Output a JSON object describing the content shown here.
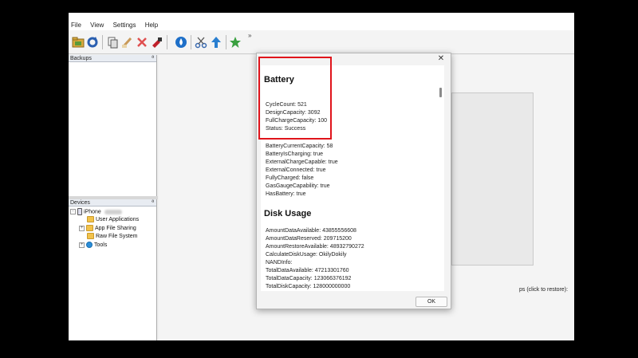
{
  "app": {
    "title": "",
    "menu": [
      "File",
      "View",
      "Settings",
      "Help"
    ],
    "toolbar_overflow": "»",
    "toolbar_icons": [
      "open-folder-icon",
      "refresh-icon",
      "copy-icon",
      "clean-icon",
      "delete-icon",
      "tool-red-icon",
      "water-drop-icon",
      "scissors-icon",
      "upload-arrow-icon",
      "star-icon"
    ]
  },
  "panels": {
    "backups": {
      "title": "Backups",
      "pin": "ª"
    },
    "devices": {
      "title": "Devices",
      "pin": "ª",
      "tree": [
        {
          "label": "iPhone",
          "icon": "phone-icon",
          "expander": "-"
        },
        {
          "label": "User Applications",
          "icon": "folder-icon",
          "expander": ""
        },
        {
          "label": "App File Sharing",
          "icon": "folder-icon",
          "expander": "+"
        },
        {
          "label": "Raw File System",
          "icon": "folder-icon",
          "expander": ""
        },
        {
          "label": "Tools",
          "icon": "tools-icon",
          "expander": "+"
        }
      ]
    }
  },
  "main": {
    "restore_hint": "ps (click to restore):"
  },
  "dialog": {
    "close": "✕",
    "battery": {
      "title": "Battery",
      "lines": [
        "CycleCount: 521",
        "DesignCapacity: 3092",
        "FullChargeCapacity: 100",
        "Status: Success",
        "BatteryCurrentCapacity: 58",
        "BatteryIsCharging: true",
        "ExternalChargeCapable: true",
        "ExternalConnected: true",
        "FullyCharged: false",
        "GasGaugeCapability: true",
        "HasBattery: true"
      ]
    },
    "disk": {
      "title": "Disk Usage",
      "lines": [
        "AmountDataAvailable: 43855556608",
        "AmountDataReserved: 209715200",
        "AmountRestoreAvailable: 48932790272",
        "CalculateDiskUsage: OkilyDokily",
        "NANDInfo:",
        "TotalDataAvailable: 47213301760",
        "TotalDataCapacity: 123066376192",
        "TotalDiskCapacity: 128000000000"
      ]
    },
    "ok_label": "OK"
  },
  "colors": {
    "highlight": "#e0141b",
    "folder": "#f2c24a",
    "tools": "#2b8ed9"
  }
}
